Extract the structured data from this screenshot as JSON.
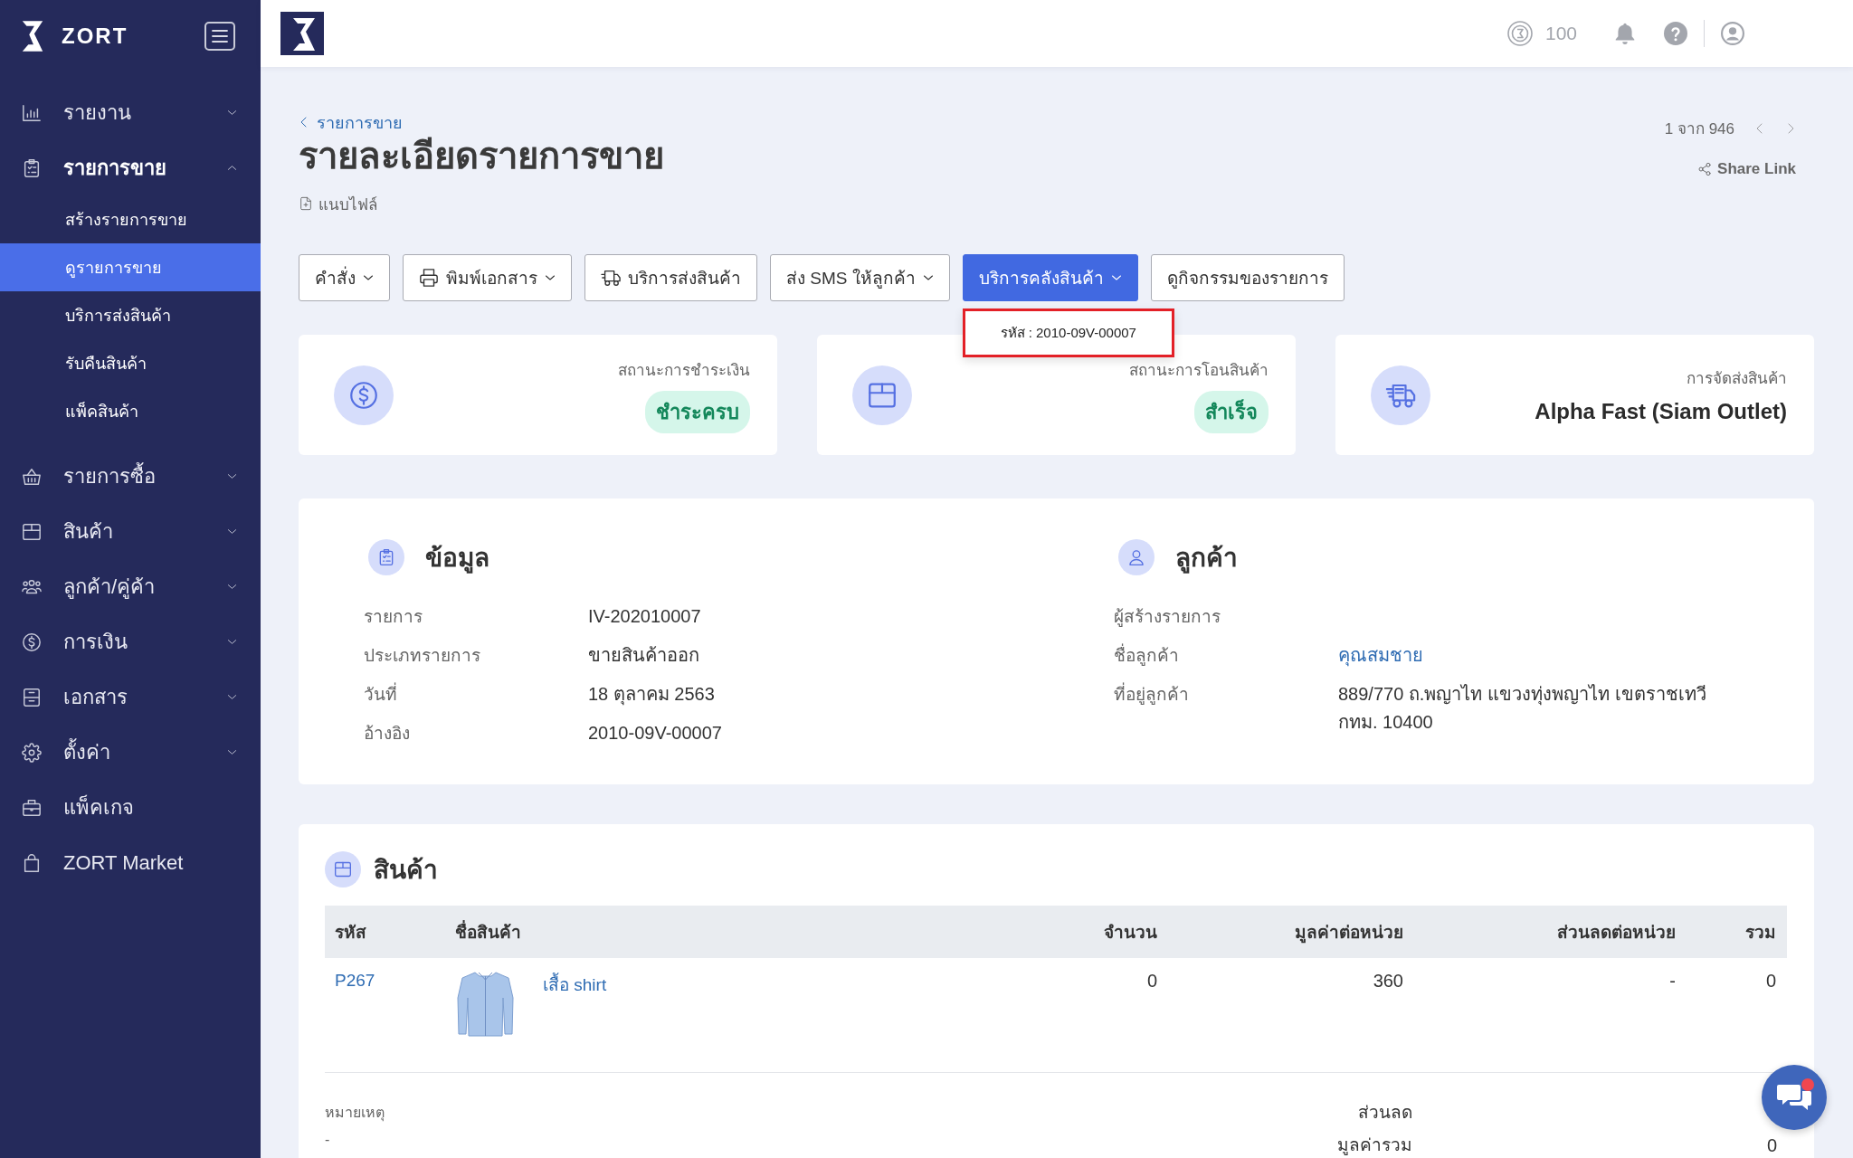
{
  "sidebar": {
    "brand": "ZORT",
    "items": [
      {
        "label": "รายงาน",
        "kind": "group",
        "expanded": false
      },
      {
        "label": "รายการขาย",
        "kind": "group",
        "expanded": true,
        "children": [
          {
            "label": "สร้างรายการขาย",
            "selected": false
          },
          {
            "label": "ดูรายการขาย",
            "selected": true
          },
          {
            "label": "บริการส่งสินค้า",
            "selected": false
          },
          {
            "label": "รับคืนสินค้า",
            "selected": false
          },
          {
            "label": "แพ็คสินค้า",
            "selected": false
          }
        ]
      },
      {
        "label": "รายการซื้อ",
        "kind": "group",
        "expanded": false
      },
      {
        "label": "สินค้า",
        "kind": "group",
        "expanded": false
      },
      {
        "label": "ลูกค้า/คู่ค้า",
        "kind": "group",
        "expanded": false
      },
      {
        "label": "การเงิน",
        "kind": "group",
        "expanded": false
      },
      {
        "label": "เอกสาร",
        "kind": "group",
        "expanded": false
      },
      {
        "label": "ตั้งค่า",
        "kind": "group",
        "expanded": false
      },
      {
        "label": "แพ็คเกจ",
        "kind": "link"
      },
      {
        "label": "ZORT Market",
        "kind": "link"
      }
    ]
  },
  "top_bar": {
    "credits": "100"
  },
  "header": {
    "breadcrumb": "รายการขาย",
    "title": "รายละเอียดรายการขาย",
    "attach": "แนบไฟล์",
    "pager": "1 จาก 946",
    "share": "Share Link"
  },
  "toolbar": {
    "buttons": [
      {
        "label": "คำสั่ง",
        "dropdown": true,
        "open": false
      },
      {
        "label": "พิมพ์เอกสาร",
        "dropdown": true,
        "open": false
      },
      {
        "label": "บริการส่งสินค้า",
        "dropdown": false,
        "open": false
      },
      {
        "label": "ส่ง SMS ให้ลูกค้า",
        "dropdown": true,
        "open": false
      },
      {
        "label": "บริการคลังสินค้า",
        "dropdown": true,
        "open": true,
        "menu": [
          {
            "label": "รหัส : 2010-09V-00007",
            "highlighted": true
          }
        ]
      },
      {
        "label": "ดูกิจกรรมของรายการ",
        "dropdown": false,
        "open": false
      }
    ]
  },
  "status_cards": [
    {
      "label": "สถานะการชำระเงิน",
      "value": "ชำระครบ",
      "kind": "badge"
    },
    {
      "label": "สถานะการโอนสินค้า",
      "value": "สำเร็จ",
      "kind": "badge"
    },
    {
      "label": "การจัดส่งสินค้า",
      "value": "Alpha Fast (Siam Outlet)",
      "kind": "text"
    }
  ],
  "info": {
    "title": "ข้อมูล",
    "rows": [
      {
        "label": "รายการ",
        "value": "IV-202010007",
        "kind": "text"
      },
      {
        "label": "ประเภทรายการ",
        "value": "ขายสินค้าออก",
        "kind": "text"
      },
      {
        "label": "วันที่",
        "value": "18 ตุลาคม 2563",
        "kind": "text"
      },
      {
        "label": "อ้างอิง",
        "value": "2010-09V-00007",
        "kind": "text"
      }
    ]
  },
  "customer": {
    "title": "ลูกค้า",
    "rows": [
      {
        "label": "ผู้สร้างรายการ"
      },
      {
        "label": "ชื่อลูกค้า",
        "value": "คุณสมชาย",
        "kind": "link"
      },
      {
        "label": "ที่อยู่ลูกค้า",
        "value": "889/770 ถ.พญาไท แขวงทุ่งพญาไท เขตราชเทวี กทม. 10400",
        "kind": "text"
      }
    ]
  },
  "products": {
    "title": "สินค้า",
    "table": {
      "columns": [
        "รหัส",
        "ชื่อสินค้า",
        "จำนวน",
        "มูลค่าต่อหน่วย",
        "ส่วนลดต่อหน่วย",
        "รวม"
      ],
      "rows": [
        {
          "code": "P267",
          "name": "เสื้อ shirt",
          "quantity": "0",
          "unit_price": "360",
          "unit_discount": "-",
          "total": "0"
        }
      ]
    },
    "notes": {
      "label": "หมายเหตุ",
      "value": "-"
    },
    "summary": [
      {
        "label": "ส่วนลด"
      },
      {
        "label": "มูลค่ารวม",
        "value": "0"
      }
    ]
  }
}
